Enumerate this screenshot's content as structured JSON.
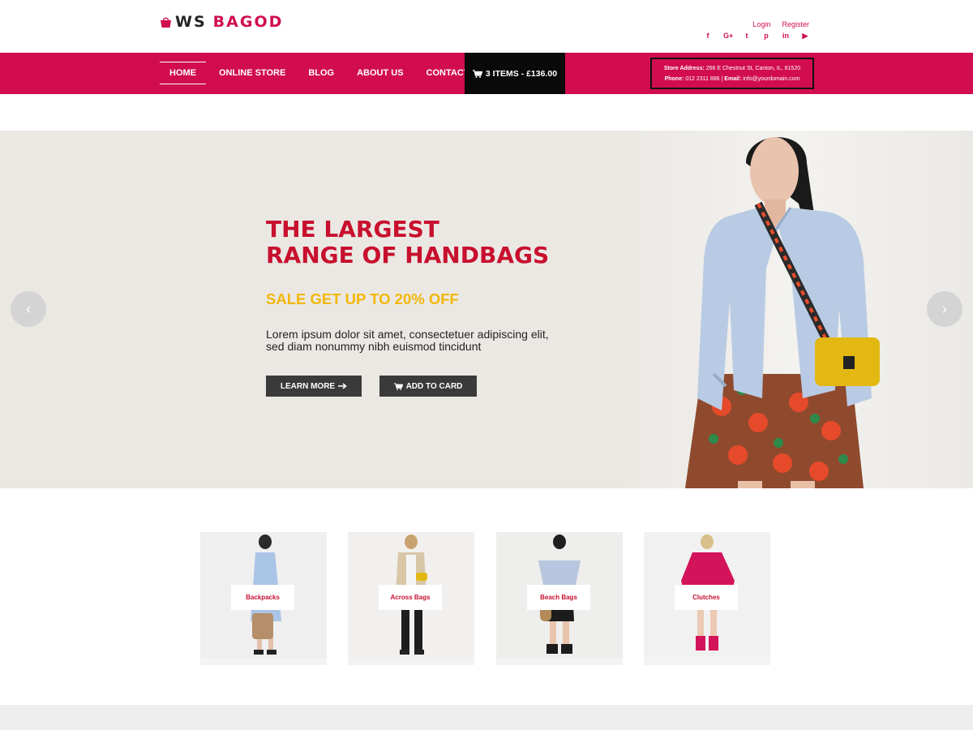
{
  "brand": {
    "prefix": "WS",
    "name": "BAGOD",
    "accent": "#d10d4f"
  },
  "header": {
    "login": "Login",
    "register": "Register",
    "socials": [
      {
        "icon": "facebook-icon",
        "glyph": "f"
      },
      {
        "icon": "google-plus-icon",
        "glyph": "G+"
      },
      {
        "icon": "twitter-icon",
        "glyph": "t"
      },
      {
        "icon": "pinterest-icon",
        "glyph": "p"
      },
      {
        "icon": "linkedin-icon",
        "glyph": "in"
      },
      {
        "icon": "youtube-icon",
        "glyph": "▶"
      }
    ]
  },
  "nav": {
    "items": [
      "HOME",
      "ONLINE STORE",
      "BLOG",
      "ABOUT US",
      "CONTACT US"
    ],
    "active": "HOME",
    "cart_label": "3 ITEMS - £136.00",
    "cart_icon": "cart-icon"
  },
  "store": {
    "address_label": "Store Address:",
    "address": "266 E Chestnut St, Canton, IL, 61520",
    "phone_label": "Phone:",
    "phone": "012 2311 886",
    "email_label": "Email:",
    "email": "info@yourdomain.com"
  },
  "hero": {
    "title_line1": "THE LARGEST",
    "title_line2": "RANGE OF HANDBAGS",
    "sale": "SALE GET UP TO 20% OFF",
    "text_line1": "Lorem ipsum dolor sit amet, consectetuer adipiscing elit,",
    "text_line2": "sed diam nonummy nibh euismod tincidunt",
    "learn_more": "LEARN MORE",
    "add_to_card": "ADD TO CARD",
    "prev": "‹",
    "next": "›"
  },
  "categories": [
    {
      "label": "Backpacks",
      "color": "#aac4e6"
    },
    {
      "label": "Across Bags",
      "color": "#d8c6a8"
    },
    {
      "label": "Beach Bags",
      "color": "#b8c6e0"
    },
    {
      "label": "Clutches",
      "color": "#d4145a"
    }
  ]
}
